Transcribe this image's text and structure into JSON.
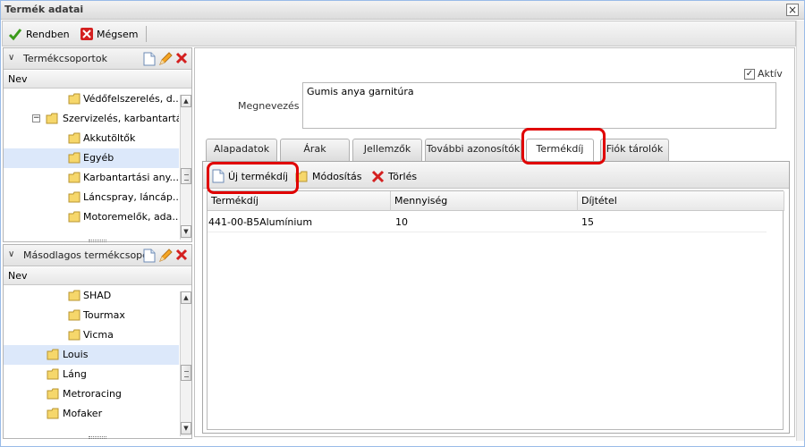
{
  "window": {
    "title": "Termék adatai",
    "close_glyph": "×"
  },
  "toolbar": {
    "ok_label": "Rendben",
    "cancel_label": "Mégsem"
  },
  "panels": {
    "groups": {
      "title": "Termékcsoportok",
      "column": "Nev",
      "items": [
        {
          "label": "Védőfelszerelés, d..."
        },
        {
          "label": "Szervizelés, karbantartás"
        },
        {
          "label": "Akkutöltők"
        },
        {
          "label": "Egyéb"
        },
        {
          "label": "Karbantartási any..."
        },
        {
          "label": "Láncspray, láncáp..."
        },
        {
          "label": "Motoremelők, ada..."
        }
      ]
    },
    "secondary": {
      "title": "Másodlagos termékcsopo",
      "column": "Nev",
      "items": [
        {
          "label": "SHAD"
        },
        {
          "label": "Tourmax"
        },
        {
          "label": "Vicma"
        },
        {
          "label": "Louis"
        },
        {
          "label": "Láng"
        },
        {
          "label": "Metroracing"
        },
        {
          "label": "Mofaker"
        }
      ]
    }
  },
  "form": {
    "active_label": "Aktív",
    "active_checked": true,
    "name_label": "Megnevezés :",
    "name_value": "Gumis anya garnitúra"
  },
  "tabs": [
    {
      "label": "Alapadatok"
    },
    {
      "label": "Árak"
    },
    {
      "label": "Jellemzők"
    },
    {
      "label": "További azonosítók"
    },
    {
      "label": "Termékdíj"
    },
    {
      "label": "Fiók tárolók"
    }
  ],
  "subtoolbar": {
    "new_label": "Új termékdíj",
    "edit_label": "Módosítás",
    "delete_label": "Törlés"
  },
  "grid": {
    "columns": [
      "Termékdíj",
      "Mennyiség",
      "Díjtétel"
    ],
    "rows": [
      [
        "441-00-B5Alumínium",
        "10",
        "15"
      ]
    ]
  },
  "colors": {
    "highlight": "#e00000",
    "selection": "#dce8fa",
    "accent": "#99bbe8"
  }
}
